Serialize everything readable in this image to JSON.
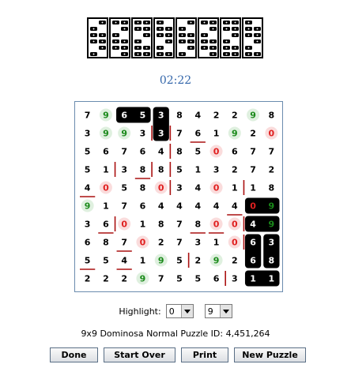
{
  "game": {
    "title": "Dominosa",
    "timer": "02:22",
    "grid": [
      [
        7,
        9,
        6,
        5,
        3,
        8,
        4,
        2,
        2,
        9,
        8
      ],
      [
        3,
        9,
        9,
        3,
        3,
        7,
        6,
        1,
        9,
        2,
        0
      ],
      [
        5,
        6,
        7,
        6,
        4,
        8,
        5,
        0,
        6,
        7,
        7
      ],
      [
        5,
        1,
        3,
        8,
        8,
        5,
        1,
        3,
        2,
        7,
        2
      ],
      [
        4,
        0,
        5,
        8,
        0,
        3,
        4,
        0,
        1,
        1,
        8
      ],
      [
        9,
        1,
        7,
        6,
        4,
        4,
        4,
        4,
        4,
        0,
        9
      ],
      [
        3,
        6,
        0,
        1,
        8,
        7,
        8,
        0,
        0,
        4,
        9
      ],
      [
        6,
        8,
        7,
        0,
        2,
        7,
        3,
        1,
        0,
        6,
        3
      ],
      [
        5,
        5,
        4,
        1,
        9,
        5,
        2,
        9,
        2,
        6,
        8
      ],
      [
        2,
        2,
        2,
        9,
        7,
        5,
        5,
        6,
        3,
        1,
        1
      ]
    ],
    "placed_dominoes": [
      {
        "cells": [
          [
            0,
            2
          ],
          [
            0,
            3
          ]
        ]
      },
      {
        "cells": [
          [
            0,
            4
          ],
          [
            1,
            4
          ]
        ]
      },
      {
        "cells": [
          [
            5,
            9
          ],
          [
            5,
            10
          ]
        ]
      },
      {
        "cells": [
          [
            6,
            9
          ],
          [
            6,
            10
          ]
        ]
      },
      {
        "cells": [
          [
            7,
            9
          ],
          [
            8,
            9
          ]
        ]
      },
      {
        "cells": [
          [
            7,
            10
          ],
          [
            8,
            10
          ]
        ]
      },
      {
        "cells": [
          [
            9,
            9
          ],
          [
            9,
            10
          ]
        ]
      }
    ],
    "highlight_green_digit": 9,
    "highlight_red_digit": 0,
    "colors": {
      "domino_bg": "#000000",
      "domino_text": "#ffffff",
      "highlight_green_text": "#1a8a1a",
      "highlight_green_bg": "#dff0df",
      "highlight_red_text": "#e02020",
      "highlight_red_bg": "#fadcdc",
      "divider": "#aa1111"
    }
  },
  "controls": {
    "highlight_label": "Highlight:",
    "highlight_a": "0",
    "highlight_b": "9"
  },
  "info": "9x9 Dominosa Normal Puzzle ID: 4,451,264",
  "buttons": {
    "done": "Done",
    "start_over": "Start Over",
    "print": "Print",
    "new_puzzle": "New Puzzle"
  }
}
